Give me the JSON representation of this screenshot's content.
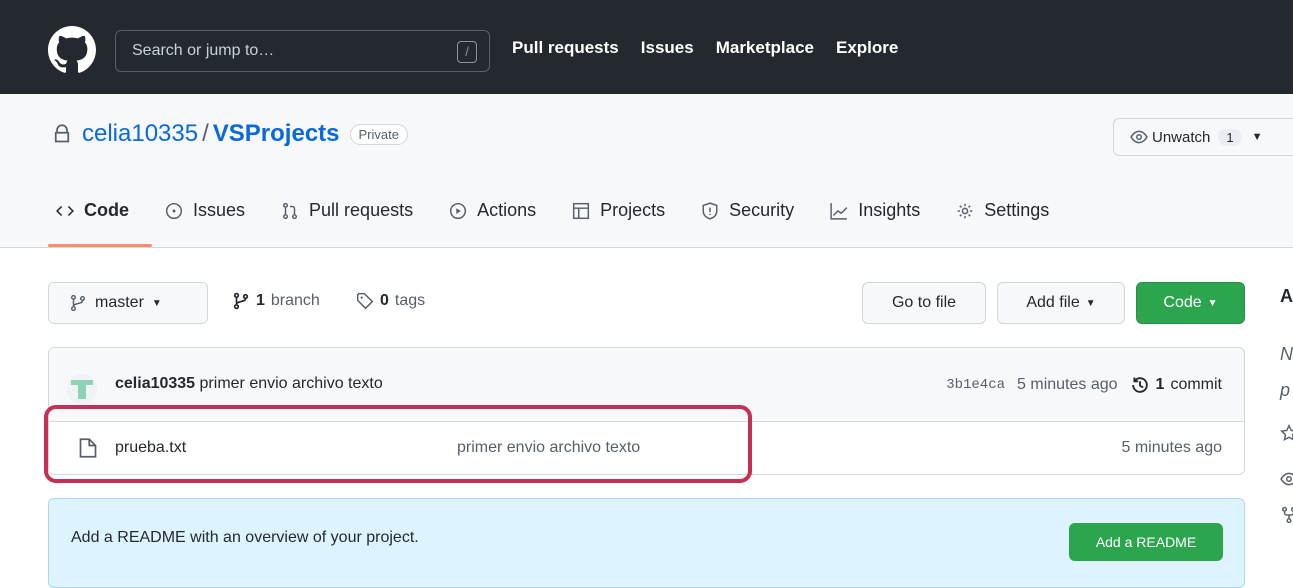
{
  "header": {
    "search_placeholder": "Search or jump to…",
    "search_shortcut": "/",
    "nav": [
      "Pull requests",
      "Issues",
      "Marketplace",
      "Explore"
    ]
  },
  "repo": {
    "owner": "celia10335",
    "separator": "/",
    "name": "VSProjects",
    "visibility": "Private",
    "watch_label": "Unwatch",
    "watch_count": "1"
  },
  "tabs": [
    {
      "label": "Code",
      "icon": "code-icon"
    },
    {
      "label": "Issues",
      "icon": "issue-icon"
    },
    {
      "label": "Pull requests",
      "icon": "pull-request-icon"
    },
    {
      "label": "Actions",
      "icon": "play-icon"
    },
    {
      "label": "Projects",
      "icon": "table-icon"
    },
    {
      "label": "Security",
      "icon": "shield-icon"
    },
    {
      "label": "Insights",
      "icon": "graph-icon"
    },
    {
      "label": "Settings",
      "icon": "gear-icon"
    }
  ],
  "toolbar": {
    "branch": "master",
    "branch_count": "1",
    "branch_label": "branch",
    "tag_count": "0",
    "tag_label": "tags",
    "go_to_file": "Go to file",
    "add_file": "Add file",
    "code": "Code"
  },
  "latest_commit": {
    "author": "celia10335",
    "message": "primer envio archivo texto",
    "sha": "3b1e4ca",
    "age": "5 minutes ago",
    "commit_count": "1",
    "commit_label": "commit"
  },
  "files": [
    {
      "name": "prueba.txt",
      "message": "primer envio archivo texto",
      "age": "5 minutes ago"
    }
  ],
  "readme": {
    "text": "Add a README with an overview of your project.",
    "button": "Add a README"
  },
  "sidebar": {
    "heading_partial": "A",
    "line1_partial": "N",
    "line2_partial": "p"
  },
  "colors": {
    "topbar": "#24292f",
    "link": "#0969da",
    "green": "#2da44e",
    "highlight": "#c53154",
    "tab_underline": "#fd8c73"
  }
}
